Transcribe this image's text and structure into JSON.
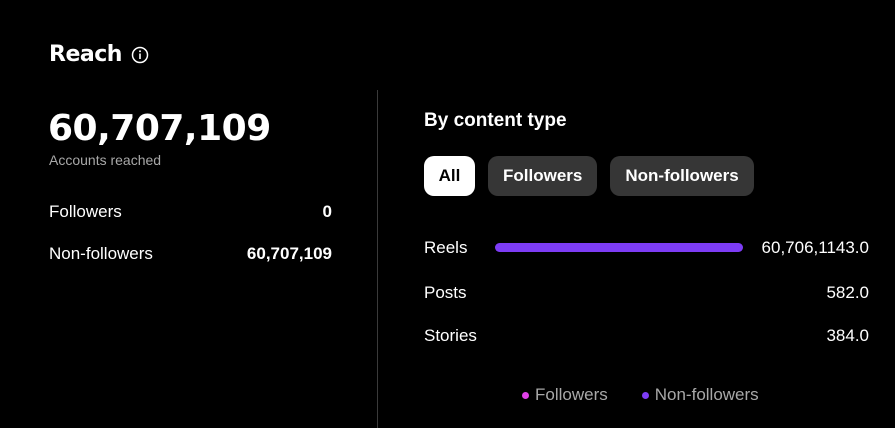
{
  "reach": {
    "title": "Reach",
    "accounts_reached": "60,707,109",
    "subtitle": "Accounts reached",
    "stats": [
      {
        "label": "Followers",
        "value": "0"
      },
      {
        "label": "Non-followers",
        "value": "60,707,109"
      }
    ]
  },
  "content_type": {
    "title": "By content type",
    "chips": [
      "All",
      "Followers",
      "Non-followers"
    ],
    "selected_chip": "All",
    "rows": [
      {
        "label": "Reels",
        "value": "60,706,1143.0",
        "non_follower_share": 1.0
      },
      {
        "label": "Posts",
        "value": "582.0",
        "non_follower_share": 0
      },
      {
        "label": "Stories",
        "value": "384.0",
        "non_follower_share": 0
      }
    ]
  },
  "legend": [
    {
      "label": "Followers",
      "color": "#e040e8"
    },
    {
      "label": "Non-followers",
      "color": "#7d3cf5"
    }
  ],
  "colors": {
    "accent": "#7d3cf5",
    "followers": "#e040e8"
  }
}
